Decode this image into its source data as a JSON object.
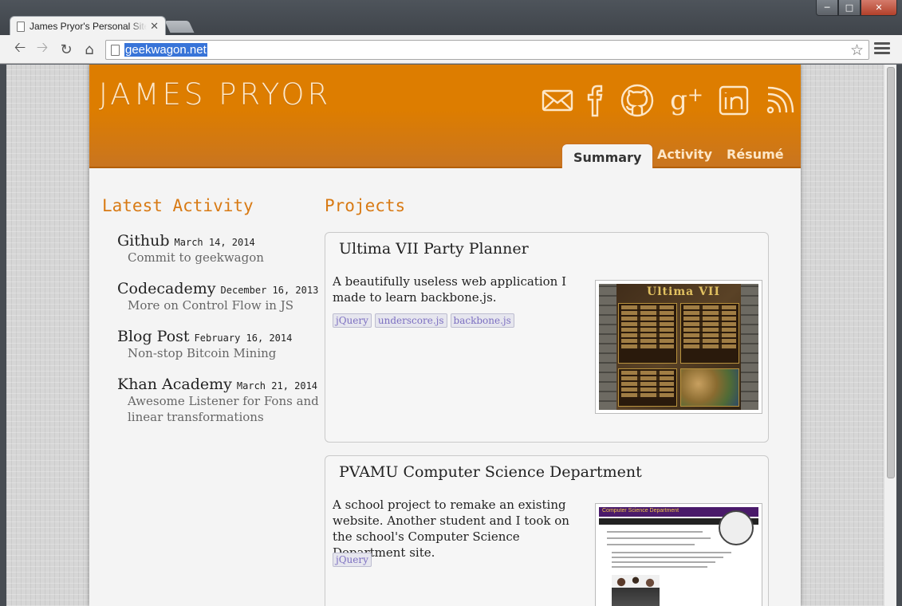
{
  "browser": {
    "tab_title": "James Pryor's Personal Site",
    "url": "geekwagon.net",
    "window_controls": [
      "minimize",
      "maximize",
      "close"
    ]
  },
  "site": {
    "name": "JAMES PRYOR",
    "social": [
      {
        "icon": "email-icon"
      },
      {
        "icon": "facebook-icon"
      },
      {
        "icon": "github-icon"
      },
      {
        "icon": "google-plus-icon"
      },
      {
        "icon": "linkedin-icon"
      },
      {
        "icon": "rss-icon"
      }
    ],
    "nav": [
      {
        "label": "Summary",
        "active": true
      },
      {
        "label": "Activity"
      },
      {
        "label": "Résumé"
      }
    ],
    "accent_color": "#dd7d00"
  },
  "activity": {
    "title": "Latest Activity",
    "items": [
      {
        "source": "Github",
        "date": "March 14, 2014",
        "desc": "Commit to geekwagon"
      },
      {
        "source": "Codecademy",
        "date": "December 16, 2013",
        "desc": "More on Control Flow in JS"
      },
      {
        "source": "Blog Post",
        "date": "February 16, 2014",
        "desc": "Non-stop Bitcoin Mining"
      },
      {
        "source": "Khan Academy",
        "date": "March 21, 2014",
        "desc": "Awesome Listener for Fons and linear transformations"
      }
    ]
  },
  "projects": {
    "title": "Projects",
    "items": [
      {
        "title": "Ultima VII Party Planner",
        "desc": "A beautifully useless web application I made to learn backbone.js.",
        "tags": [
          "jQuery",
          "underscore.js",
          "backbone.js"
        ],
        "thumb_text": "Ultima VII"
      },
      {
        "title": "PVAMU Computer Science Department",
        "desc": "A school project to remake an existing website. Another student and I took on the school's Computer Science Department site.",
        "tags": [
          "jQuery"
        ],
        "thumb_text": "Computer Science Department"
      }
    ]
  }
}
